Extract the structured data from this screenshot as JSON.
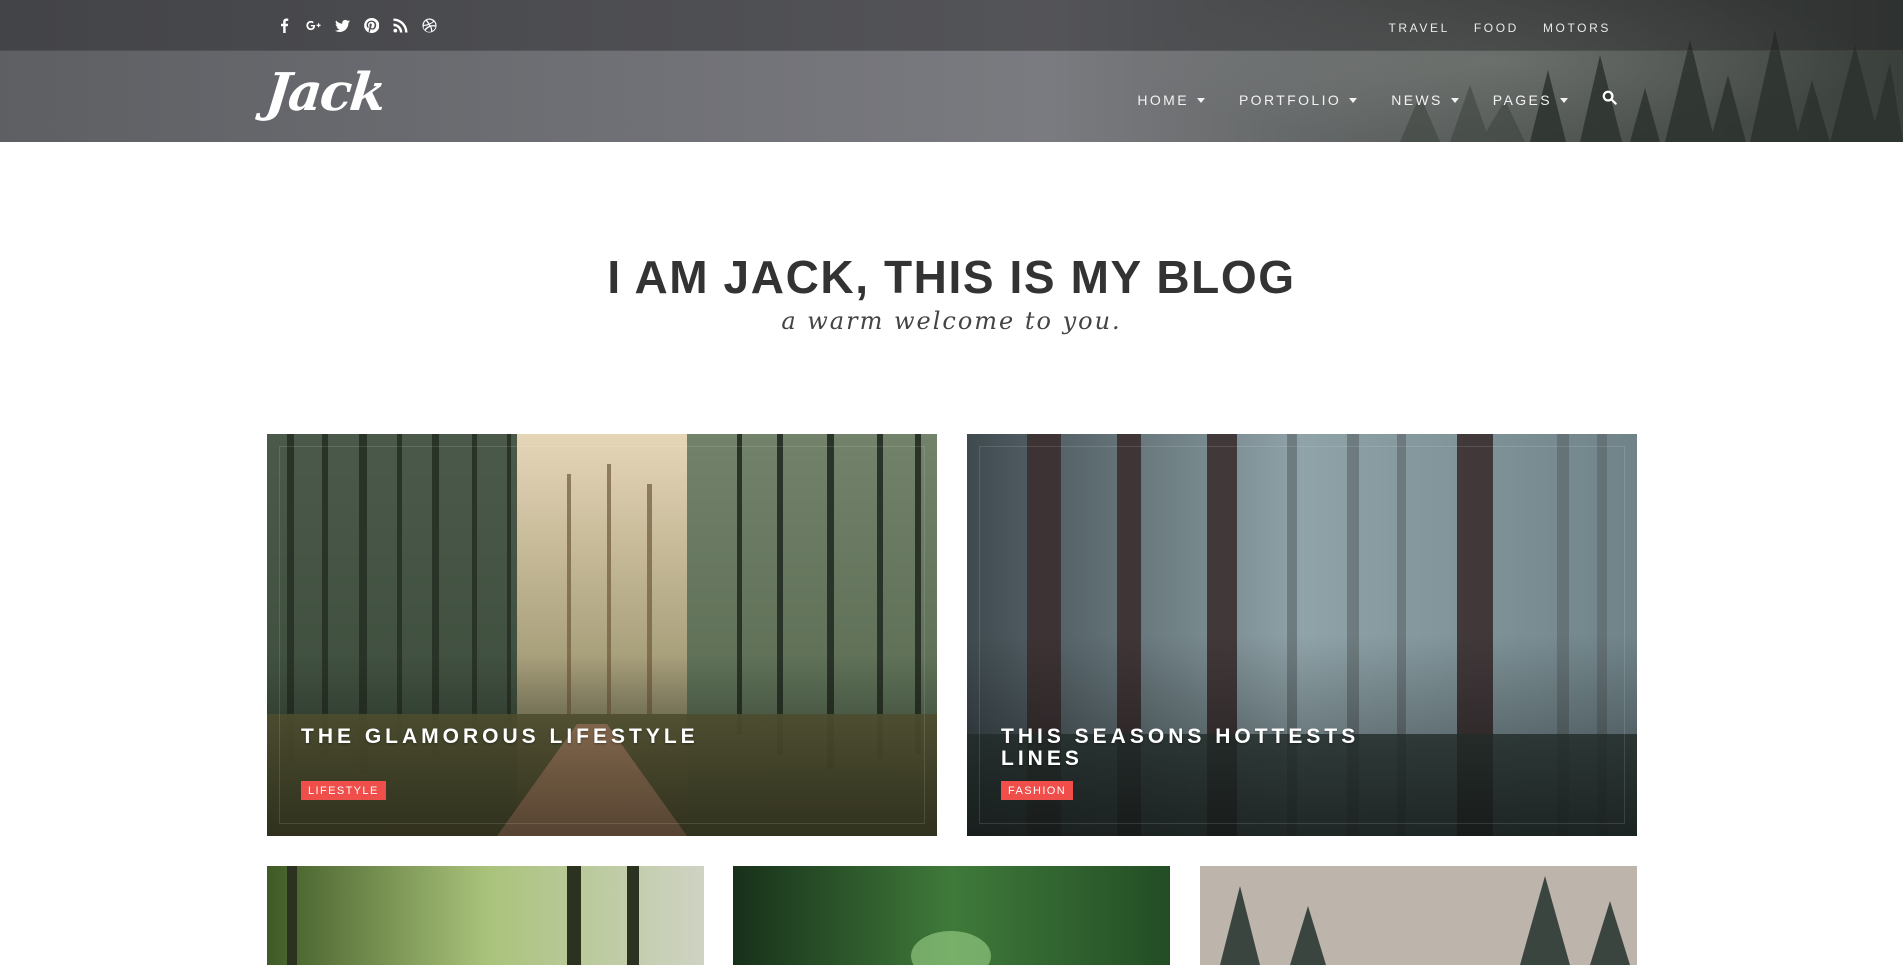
{
  "social": {
    "icons": [
      "facebook-icon",
      "google-plus-icon",
      "twitter-icon",
      "pinterest-icon",
      "rss-icon",
      "dribbble-icon"
    ]
  },
  "top_links": [
    "TRAVEL",
    "FOOD",
    "MOTORS"
  ],
  "logo": "Jack",
  "nav": {
    "items": [
      {
        "label": "HOME"
      },
      {
        "label": "PORTFOLIO"
      },
      {
        "label": "NEWS"
      },
      {
        "label": "PAGES"
      }
    ],
    "search_icon": "search-icon"
  },
  "hero": {
    "title": "I AM JACK, THIS IS MY BLOG",
    "subtitle": "a warm welcome to you."
  },
  "featured": [
    {
      "title": "THE GLAMOROUS LIFESTYLE",
      "category": "LIFESTYLE"
    },
    {
      "title": "THIS SEASONS HOTTESTS LINES",
      "category": "FASHION"
    }
  ],
  "colors": {
    "accent": "#ef4e4b",
    "heading": "#333333"
  }
}
